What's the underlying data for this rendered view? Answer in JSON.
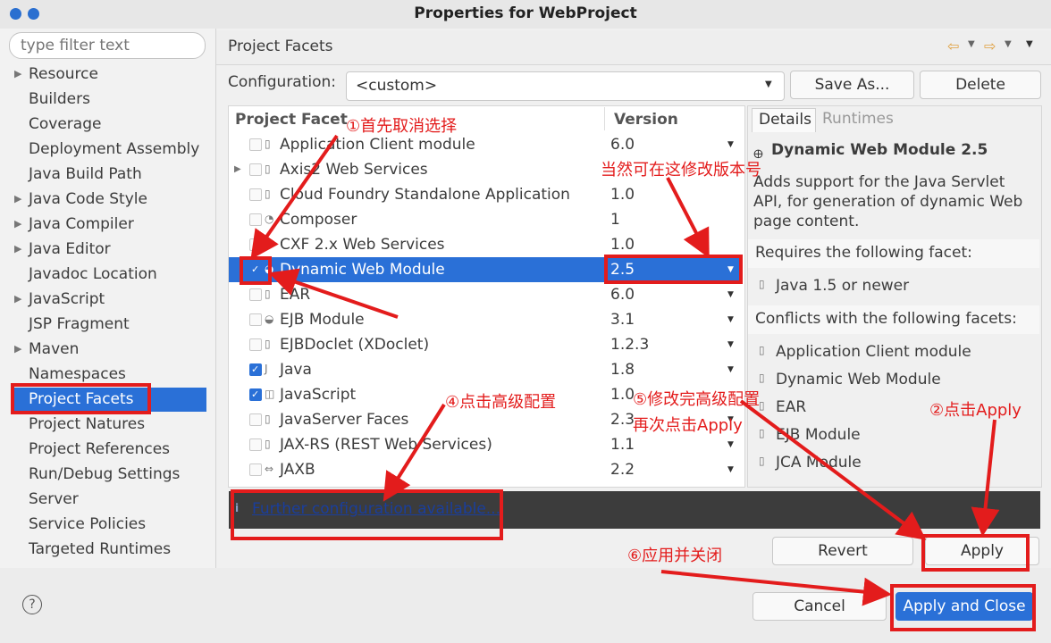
{
  "window": {
    "title": "Properties for WebProject"
  },
  "sidebar": {
    "filter_placeholder": "type filter text",
    "items": [
      {
        "label": "Resource",
        "expandable": true
      },
      {
        "label": "Builders",
        "expandable": false
      },
      {
        "label": "Coverage",
        "expandable": false
      },
      {
        "label": "Deployment Assembly",
        "expandable": false
      },
      {
        "label": "Java Build Path",
        "expandable": false
      },
      {
        "label": "Java Code Style",
        "expandable": true
      },
      {
        "label": "Java Compiler",
        "expandable": true
      },
      {
        "label": "Java Editor",
        "expandable": true
      },
      {
        "label": "Javadoc Location",
        "expandable": false
      },
      {
        "label": "JavaScript",
        "expandable": true
      },
      {
        "label": "JSP Fragment",
        "expandable": false
      },
      {
        "label": "Maven",
        "expandable": true
      },
      {
        "label": "Namespaces",
        "expandable": false
      },
      {
        "label": "Project Facets",
        "expandable": false,
        "selected": true
      },
      {
        "label": "Project Natures",
        "expandable": false
      },
      {
        "label": "Project References",
        "expandable": false
      },
      {
        "label": "Run/Debug Settings",
        "expandable": false
      },
      {
        "label": "Server",
        "expandable": false
      },
      {
        "label": "Service Policies",
        "expandable": false
      },
      {
        "label": "Targeted Runtimes",
        "expandable": false
      }
    ]
  },
  "header": {
    "title": "Project Facets"
  },
  "config": {
    "label": "Configuration:",
    "value": "<custom>",
    "save_as": "Save As...",
    "delete": "Delete"
  },
  "facets": {
    "col_facet": "Project Facet",
    "col_version": "Version",
    "rows": [
      {
        "name": "Application Client module",
        "version": "6.0",
        "checked": false,
        "dropdown": true,
        "icon": "doc-icon"
      },
      {
        "name": "Axis2 Web Services",
        "version": "",
        "checked": false,
        "dropdown": false,
        "expandable": true,
        "icon": "doc-icon"
      },
      {
        "name": "Cloud Foundry Standalone Application",
        "version": "1.0",
        "checked": false,
        "dropdown": false,
        "icon": "doc-icon"
      },
      {
        "name": "Composer",
        "version": "1",
        "checked": false,
        "dropdown": false,
        "icon": "composer-icon"
      },
      {
        "name": "CXF 2.x Web Services",
        "version": "1.0",
        "checked": false,
        "dropdown": false,
        "icon": "doc-icon"
      },
      {
        "name": "Dynamic Web Module",
        "version": "2.5",
        "checked": true,
        "dropdown": true,
        "selected": true,
        "icon": "web-module-icon"
      },
      {
        "name": "EAR",
        "version": "6.0",
        "checked": false,
        "dropdown": true,
        "icon": "doc-icon"
      },
      {
        "name": "EJB Module",
        "version": "3.1",
        "checked": false,
        "dropdown": true,
        "icon": "ejb-icon"
      },
      {
        "name": "EJBDoclet (XDoclet)",
        "version": "1.2.3",
        "checked": false,
        "dropdown": true,
        "icon": "doc-icon"
      },
      {
        "name": "Java",
        "version": "1.8",
        "checked": true,
        "dropdown": true,
        "icon": "java-icon"
      },
      {
        "name": "JavaScript",
        "version": "1.0",
        "checked": true,
        "dropdown": false,
        "icon": "js-icon"
      },
      {
        "name": "JavaServer Faces",
        "version": "2.3",
        "checked": false,
        "dropdown": true,
        "icon": "doc-icon"
      },
      {
        "name": "JAX-RS (REST Web Services)",
        "version": "1.1",
        "checked": false,
        "dropdown": true,
        "icon": "doc-icon"
      },
      {
        "name": "JAXB",
        "version": "2.2",
        "checked": false,
        "dropdown": true,
        "icon": "jaxb-icon"
      }
    ]
  },
  "details": {
    "tab_details": "Details",
    "tab_runtimes": "Runtimes",
    "title": "Dynamic Web Module 2.5",
    "description_lines": [
      "Adds support for the Java Servlet",
      "API, for generation of dynamic Web",
      "page content."
    ],
    "requires_label": "Requires the following facet:",
    "requires": [
      "Java 1.5 or newer"
    ],
    "conflicts_label": "Conflicts with the following facets:",
    "conflicts": [
      "Application Client module",
      "Dynamic Web Module",
      "EAR",
      "EJB Module",
      "JCA Module"
    ]
  },
  "infobar": {
    "link": "Further configuration available..."
  },
  "buttons": {
    "revert": "Revert",
    "apply": "Apply",
    "cancel": "Cancel",
    "apply_close": "Apply and Close",
    "help": "?"
  },
  "annotations": {
    "a1": "①首先取消选择",
    "a2": "当然可在这修改版本号",
    "a3": "④点击高级配置",
    "a4_line1": "⑤修改完高级配置",
    "a4_line2": "再次点击Apply",
    "a5": "②点击Apply",
    "a6": "⑥应用并关闭"
  },
  "colors": {
    "accent": "#2a70d7",
    "annotation": "#e31c1c",
    "infobar": "#3c3c3c"
  }
}
